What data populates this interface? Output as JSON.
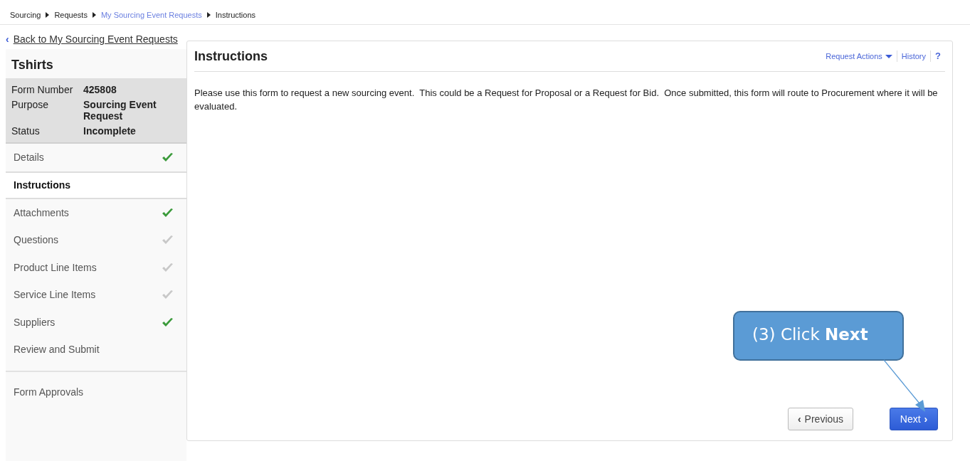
{
  "breadcrumb": [
    {
      "label": "Sourcing",
      "link": false
    },
    {
      "label": "Requests",
      "link": false
    },
    {
      "label": "My Sourcing Event Requests",
      "link": true
    },
    {
      "label": "Instructions",
      "link": false
    }
  ],
  "back_link": {
    "icon": "‹",
    "label": "Back to My Sourcing Event Requests"
  },
  "sidebar": {
    "title": "Tshirts",
    "summary": [
      {
        "label": "Form Number",
        "value": "425808"
      },
      {
        "label": "Purpose",
        "value": "Sourcing Event Request"
      },
      {
        "label": "Status",
        "value": "Incomplete"
      }
    ],
    "steps": [
      {
        "label": "Details",
        "kind": "complete",
        "selected": false
      },
      {
        "label": "Instructions",
        "kind": "plain",
        "selected": true
      },
      {
        "label": "Attachments",
        "kind": "complete",
        "selected": false
      },
      {
        "label": "Questions",
        "kind": "pending",
        "selected": false
      },
      {
        "label": "Product Line Items",
        "kind": "pending",
        "selected": false
      },
      {
        "label": "Service Line Items",
        "kind": "pending",
        "selected": false
      },
      {
        "label": "Suppliers",
        "kind": "complete",
        "selected": false
      },
      {
        "label": "Review and Submit",
        "kind": "plain",
        "selected": false
      }
    ],
    "extra": [
      {
        "label": "Form Approvals"
      }
    ]
  },
  "panel": {
    "title": "Instructions",
    "actions": [
      {
        "label": "Request Actions",
        "kind": "dropdown"
      },
      {
        "label": "History",
        "kind": "link"
      },
      {
        "label": "?",
        "kind": "help"
      }
    ],
    "text": "Please use this form to request a new sourcing event.  This could be a Request for Proposal or a Request for Bid.  Once submitted, this form will route to Procurement where it will be evaluated.",
    "buttons": [
      {
        "label": "Previous",
        "icon": "‹",
        "kind": "secondary"
      },
      {
        "label": "Next",
        "icon": "›",
        "kind": "primary"
      }
    ]
  },
  "callout": {
    "text": "(3) Click **Next**"
  }
}
